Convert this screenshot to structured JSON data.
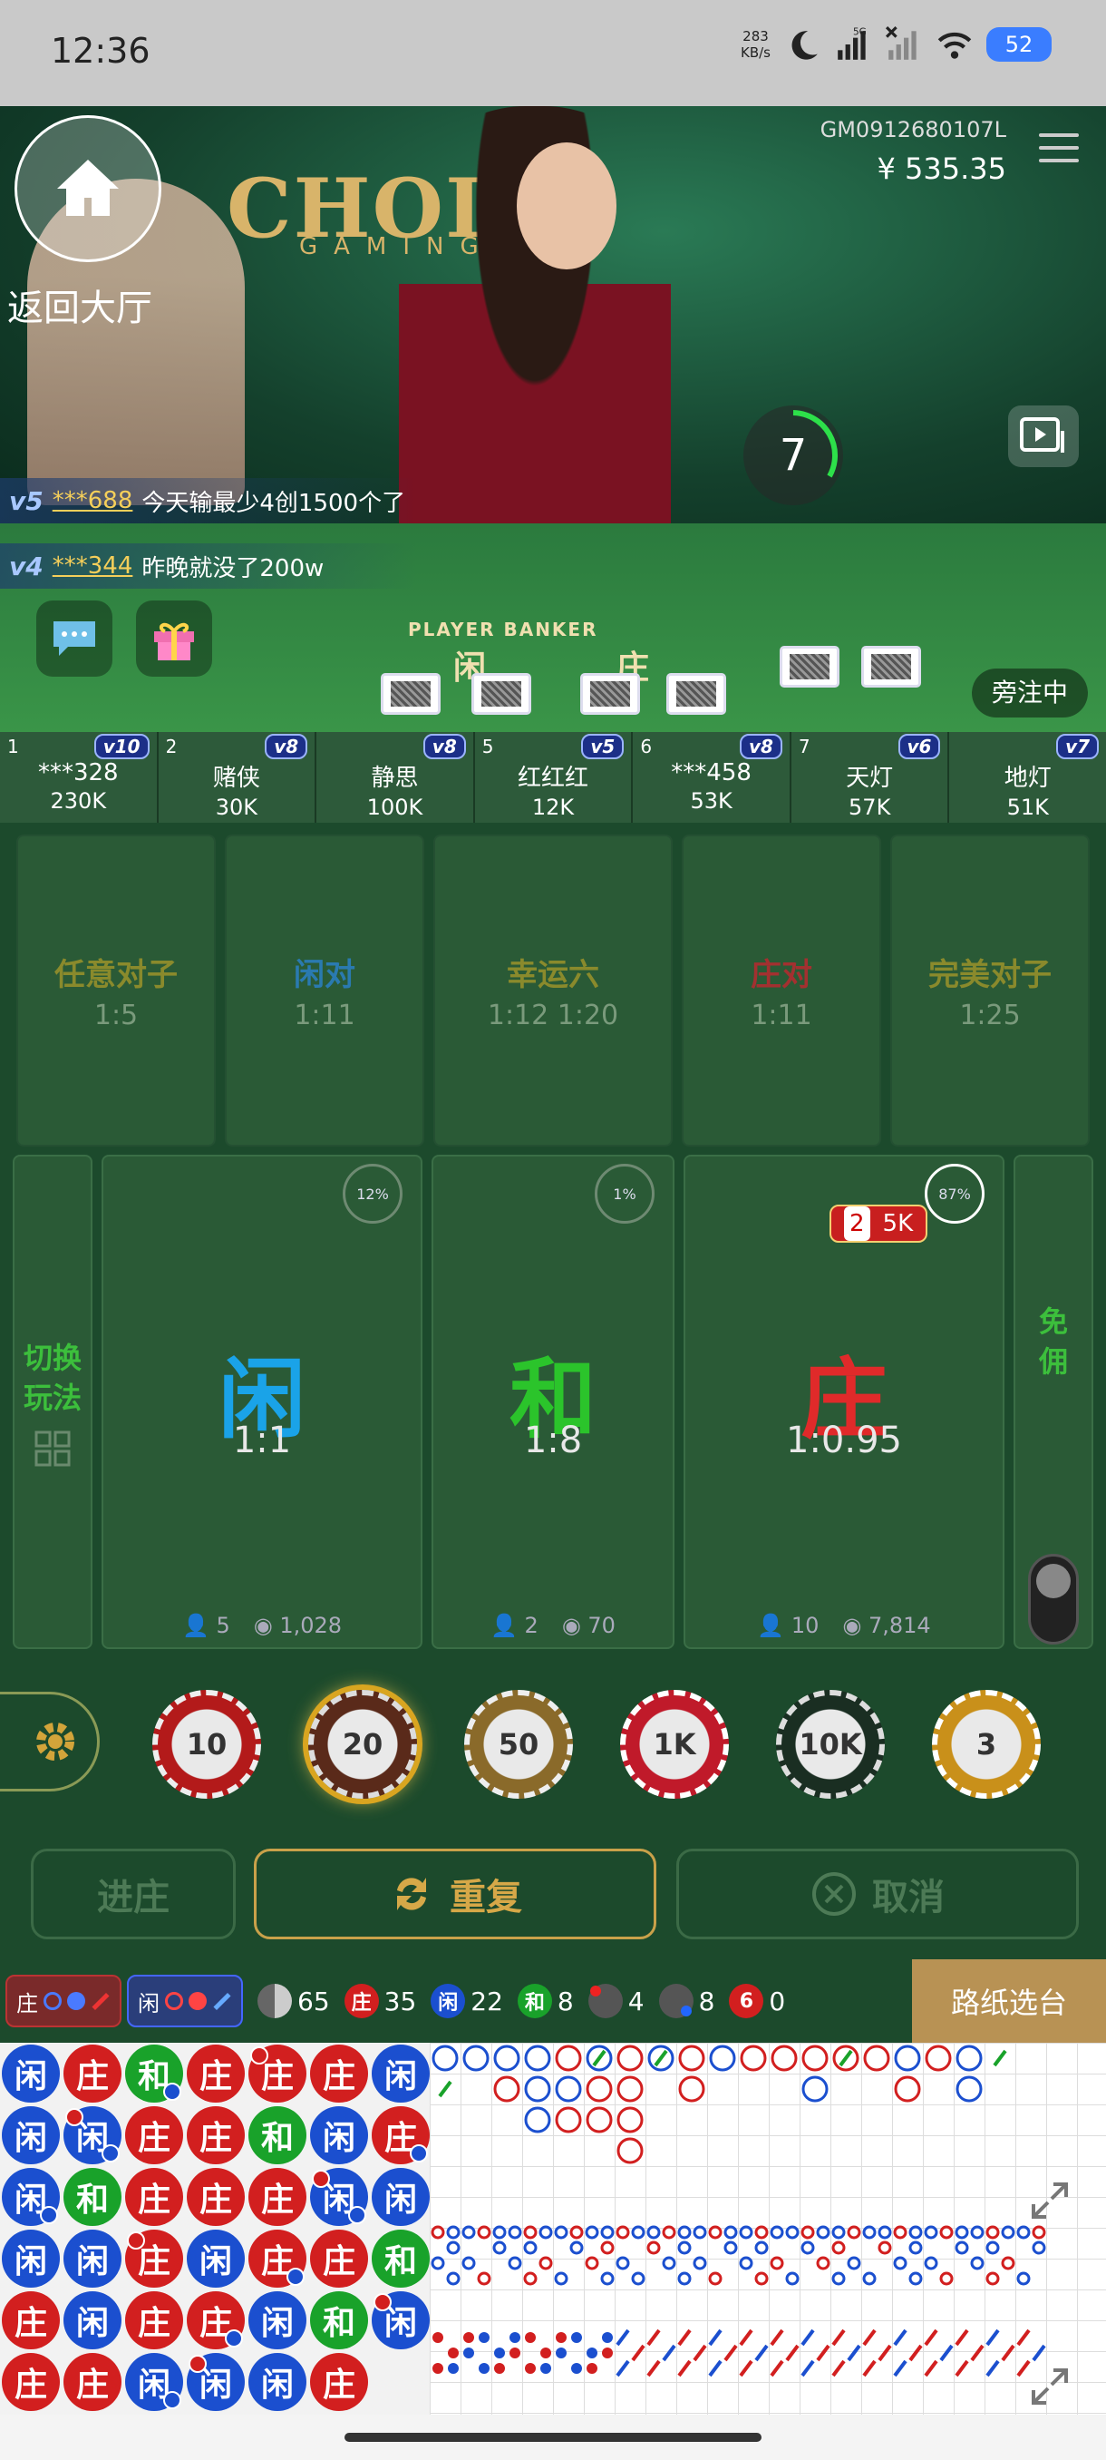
{
  "status_bar": {
    "time": "12:36",
    "net_speed_value": "283",
    "net_speed_unit": "KB/s",
    "battery": "52",
    "network_label": "5G"
  },
  "video": {
    "logo": "CHOICE",
    "logo_sub": "GAMING",
    "back_label": "返回大厅",
    "table_id": "GM0912680107L",
    "balance": "¥ 535.35",
    "countdown": "7",
    "board_en": "PLAYER    BANKER",
    "board_player": "闲",
    "board_banker": "庄",
    "status": "旁注中",
    "chats": [
      {
        "vip": "v5",
        "user": "***688",
        "text": "今天输最少4创1500个了"
      },
      {
        "vip": "v4",
        "user": "***344",
        "text": "昨晚就没了200w"
      }
    ]
  },
  "players": [
    {
      "seat": "1",
      "vip": "v10",
      "name": "***328",
      "amount": "230K"
    },
    {
      "seat": "2",
      "vip": "v8",
      "name": "赌侠",
      "amount": "30K"
    },
    {
      "seat": "",
      "vip": "v8",
      "name": "静思",
      "amount": "100K"
    },
    {
      "seat": "5",
      "vip": "v5",
      "name": "红红红",
      "amount": "12K"
    },
    {
      "seat": "6",
      "vip": "v8",
      "name": "***458",
      "amount": "53K"
    },
    {
      "seat": "7",
      "vip": "v6",
      "name": "天灯",
      "amount": "57K"
    },
    {
      "seat": "",
      "vip": "v7",
      "name": "地灯",
      "amount": "51K"
    }
  ],
  "side_bets": [
    {
      "title": "任意对子",
      "odds": "1:5",
      "color": "#8a8a2c"
    },
    {
      "title": "闲对",
      "odds": "1:11",
      "color": "#2a7ab0"
    },
    {
      "title": "幸运六",
      "odds": "1:12   1:20",
      "color": "#8a8a2c"
    },
    {
      "title": "庄对",
      "odds": "1:11",
      "color": "#a33030"
    },
    {
      "title": "完美对子",
      "odds": "1:25",
      "color": "#8a8a2c"
    }
  ],
  "main_bets": {
    "switch_label_1": "切换",
    "switch_label_2": "玩法",
    "commission_1": "免",
    "commission_2": "佣",
    "player": {
      "label": "闲",
      "odds": "1:1",
      "pct": "12%",
      "players": "5",
      "amount": "1,028",
      "color": "#1aa3e8"
    },
    "tie": {
      "label": "和",
      "odds": "1:8",
      "pct": "1%",
      "players": "2",
      "amount": "70",
      "color": "#2bc42b"
    },
    "banker": {
      "label": "庄",
      "odds": "1:0.95",
      "pct": "87%",
      "players": "10",
      "amount": "7,814",
      "color": "#e02a2a"
    },
    "placed_bet_count": "2",
    "placed_bet_amount": "5K"
  },
  "chips": [
    "10",
    "20",
    "50",
    "1K",
    "10K",
    "3"
  ],
  "selected_chip": "20",
  "actions": {
    "confirm": "进庄",
    "repeat": "重复",
    "cancel": "取消"
  },
  "road_header": {
    "banker_ask": "庄",
    "player_ask": "闲",
    "total": "65",
    "banker_count": "35",
    "player_count": "22",
    "tie_count": "8",
    "banker_pair_count": "4",
    "player_pair_count": "8",
    "six_count": "0",
    "switch_table": "路纸选台",
    "dot_banker": "庄",
    "dot_player": "闲",
    "dot_tie": "和",
    "dot_six": "6"
  },
  "bead_plate": [
    [
      "闲",
      "闲",
      "闲",
      "闲",
      "庄",
      "庄"
    ],
    [
      "庄",
      "闲",
      "和",
      "闲",
      "闲",
      "庄"
    ],
    [
      "和",
      "庄",
      "庄",
      "庄",
      "庄",
      "闲"
    ],
    [
      "庄",
      "庄",
      "庄",
      "闲",
      "庄",
      "闲"
    ],
    [
      "庄",
      "和",
      "庄",
      "庄",
      "闲",
      "闲"
    ],
    [
      "庄",
      "闲",
      "闲",
      "庄",
      "和",
      "庄"
    ],
    [
      "闲",
      "庄",
      "闲",
      "和",
      "闲",
      ""
    ]
  ],
  "colors": {
    "banker": "#d21f1f",
    "player": "#1b4fcf",
    "tie": "#19a22a",
    "felt": "#1c4a2c",
    "gold": "#b89254"
  }
}
